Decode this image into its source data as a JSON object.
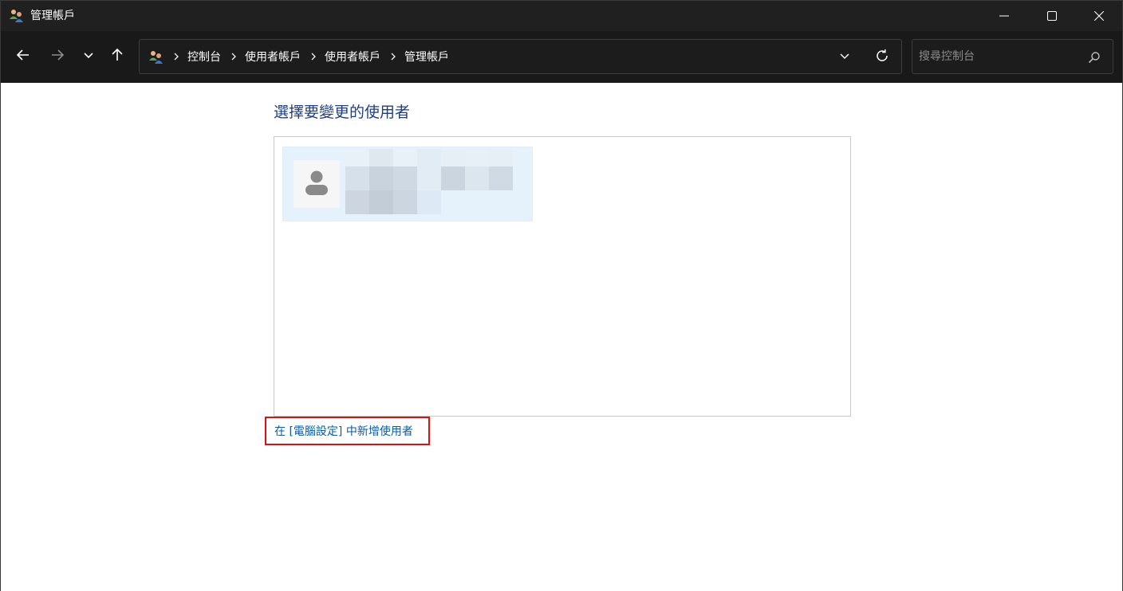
{
  "window": {
    "title": "管理帳戶",
    "minimize_icon": "minimize-icon",
    "maximize_icon": "maximize-icon",
    "close_icon": "close-icon"
  },
  "nav": {
    "back_icon": "arrow-left-icon",
    "forward_icon": "arrow-right-icon",
    "recent_icon": "chevron-down-icon",
    "up_icon": "arrow-up-icon"
  },
  "address": {
    "icon": "user-accounts-icon",
    "breadcrumbs": [
      "控制台",
      "使用者帳戶",
      "使用者帳戶",
      "管理帳戶"
    ],
    "dropdown_icon": "chevron-down-icon",
    "refresh_icon": "refresh-icon"
  },
  "search": {
    "placeholder": "搜尋控制台",
    "value": "",
    "icon": "search-icon"
  },
  "main": {
    "heading": "選擇要變更的使用者",
    "users": [
      {
        "avatar_icon": "user-avatar-icon",
        "name": "",
        "details": ""
      }
    ],
    "add_user_link": "在 [電腦設定] 中新增使用者",
    "colors": {
      "heading": "#1e3f86",
      "link": "#0b5ba8",
      "selected_tile": "#e5f1fb",
      "highlight_border": "#e01010"
    }
  }
}
